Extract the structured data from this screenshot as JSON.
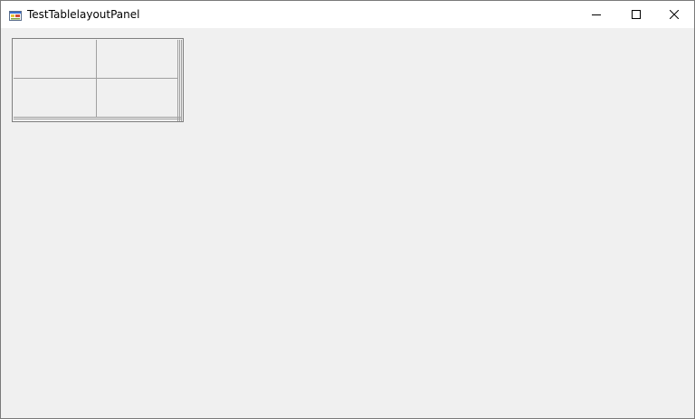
{
  "window": {
    "title": "TestTablelayoutPanel"
  },
  "icons": {
    "app": "winforms-app-icon",
    "minimize": "minimize-icon",
    "maximize": "maximize-icon",
    "close": "close-icon"
  },
  "table_layout_panel": {
    "columns": 2,
    "rows": 2
  }
}
